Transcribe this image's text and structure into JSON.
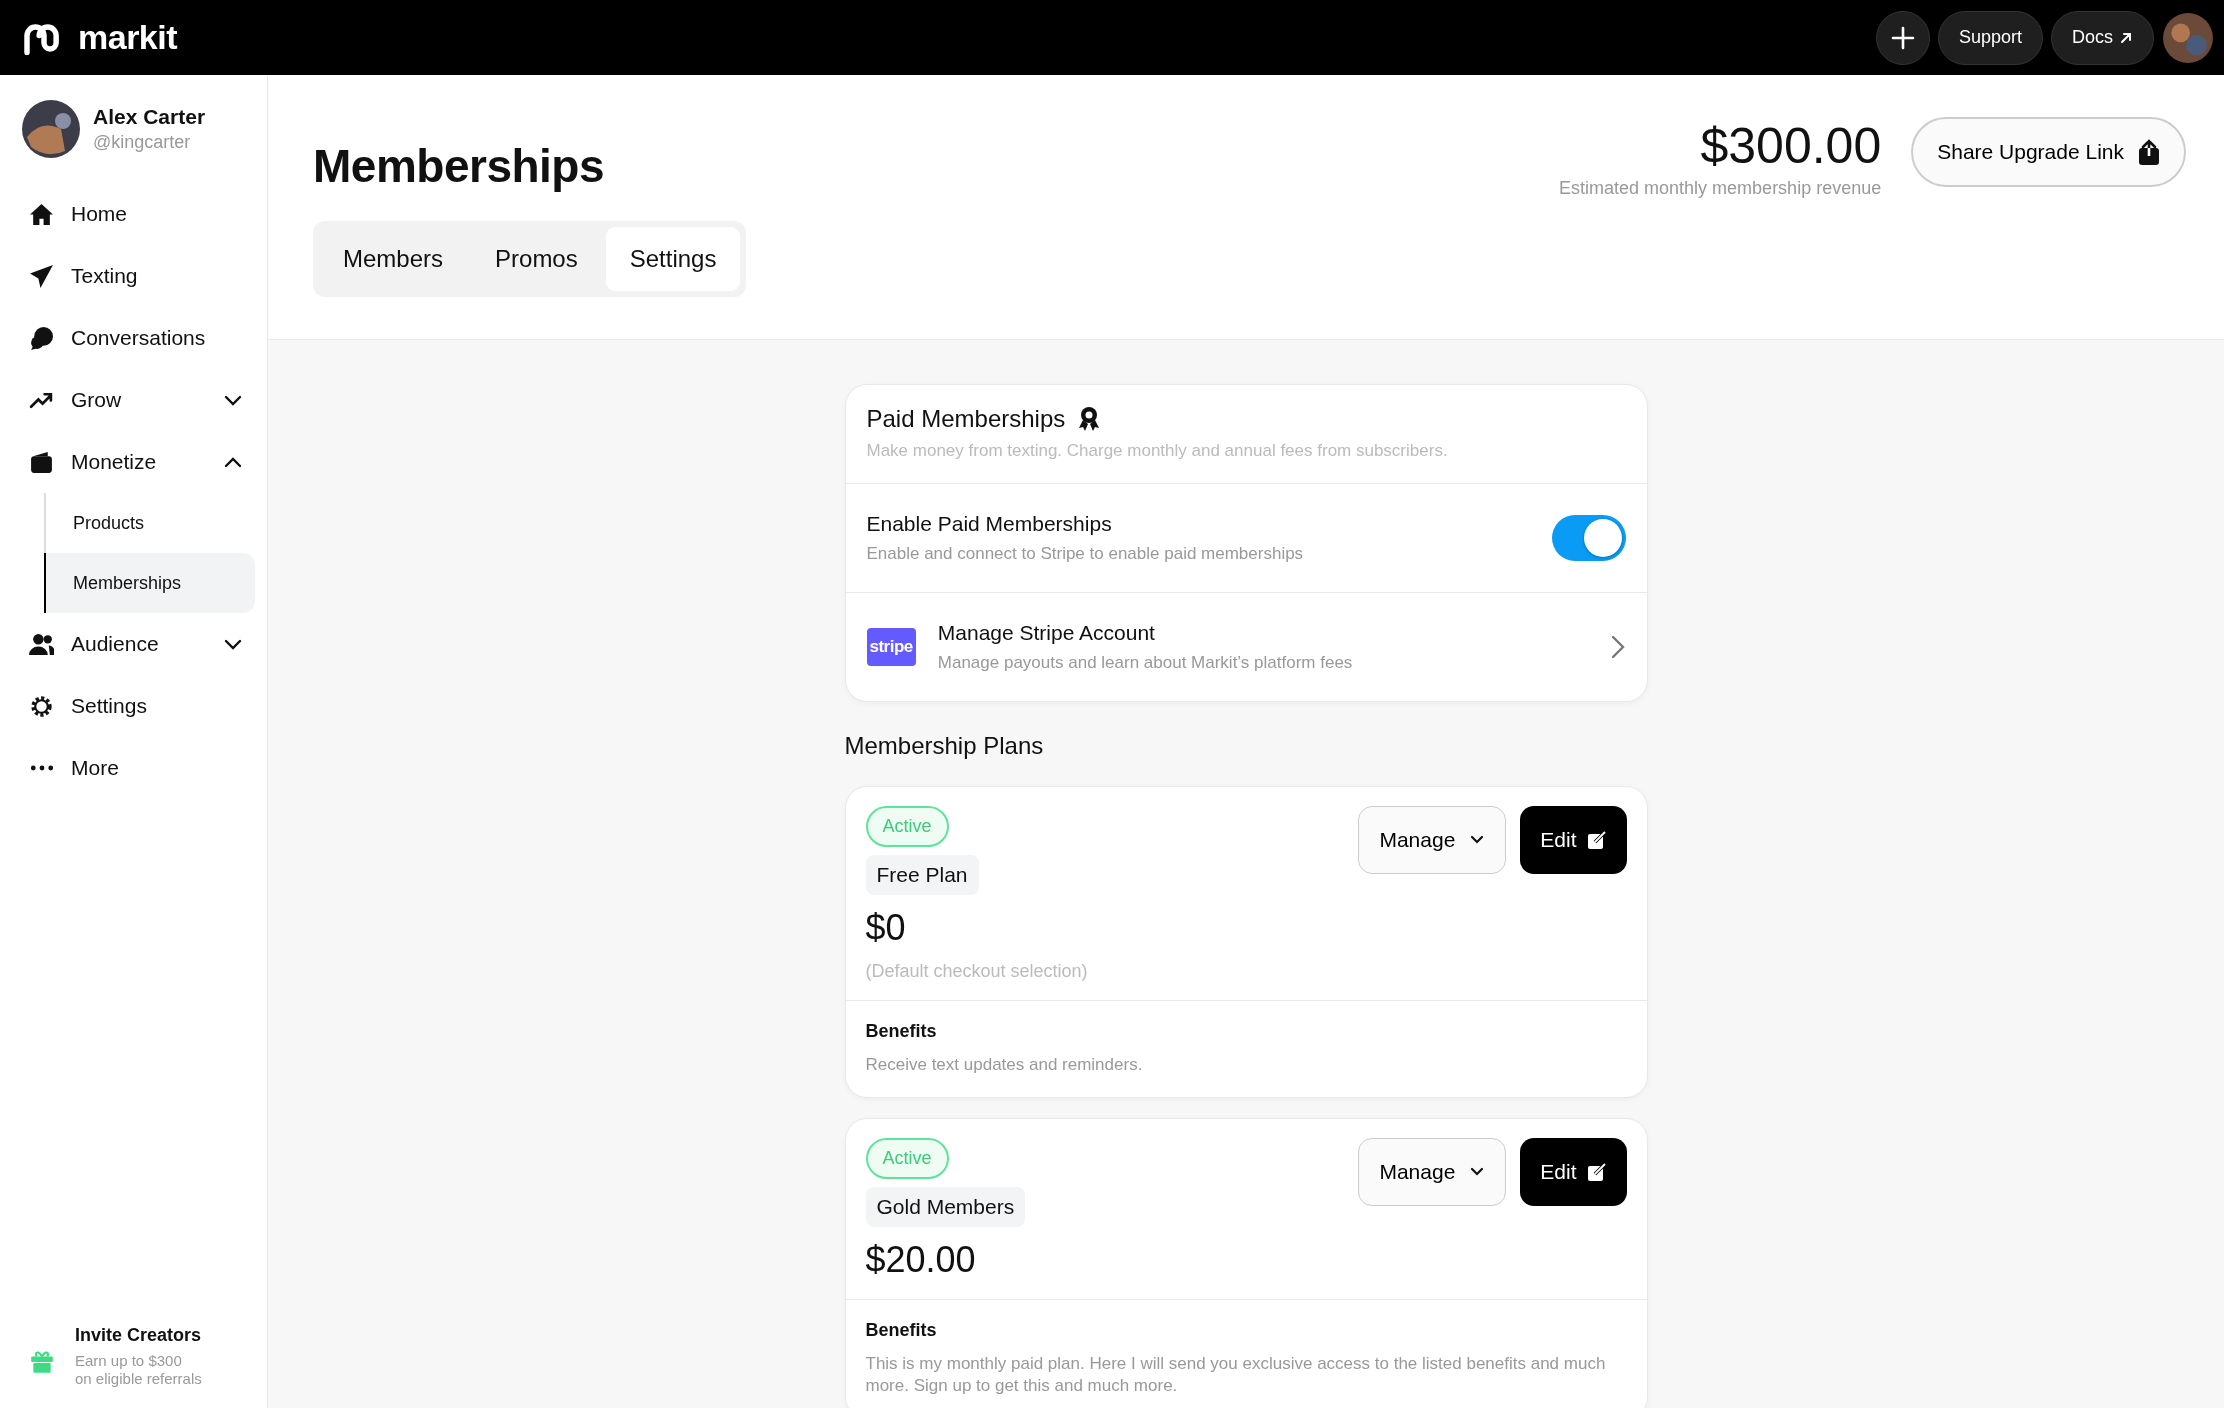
{
  "topbar": {
    "brand": "markit",
    "buttons": [
      "Support",
      "Docs"
    ]
  },
  "profile": {
    "name": "Alex Carter",
    "handle": "@kingcarter"
  },
  "nav": [
    {
      "label": "Home"
    },
    {
      "label": "Texting"
    },
    {
      "label": "Conversations"
    },
    {
      "label": "Grow",
      "expanded": false
    },
    {
      "label": "Monetize",
      "expanded": true,
      "children": [
        {
          "label": "Products",
          "selected": false
        },
        {
          "label": "Memberships",
          "selected": true
        }
      ]
    },
    {
      "label": "Audience",
      "expanded": false
    },
    {
      "label": "Settings"
    },
    {
      "label": "More"
    }
  ],
  "invite": {
    "title": "Invite Creators",
    "text": "Earn up to $300\non eligible referrals"
  },
  "page": {
    "title": "Memberships",
    "revenue": "$300.00",
    "revenue_label": "Estimated monthly membership revenue",
    "share_button": "Share Upgrade Link"
  },
  "tabs": [
    {
      "label": "Members",
      "selected": false
    },
    {
      "label": "Promos",
      "selected": false
    },
    {
      "label": "Settings",
      "selected": true
    }
  ],
  "paid": {
    "title": "Paid Memberships",
    "subtitle": "Make money from texting. Charge monthly and annual fees from subscribers.",
    "enable": {
      "title": "Enable Paid Memberships",
      "text": "Enable and connect to Stripe to enable paid memberships",
      "on": true
    },
    "stripe": {
      "logo_text": "stripe",
      "title": "Manage Stripe Account",
      "text": "Manage payouts and learn about Markit’s platform fees"
    }
  },
  "plans_title": "Membership Plans",
  "plans": [
    {
      "status": "Active",
      "name": "Free Plan",
      "price": "$0",
      "note": "(Default checkout selection)",
      "manage": "Manage",
      "edit": "Edit",
      "benefits_label": "Benefits",
      "benefits": "Receive text updates and reminders."
    },
    {
      "status": "Active",
      "name": "Gold Members",
      "price": "$20.00",
      "manage": "Manage",
      "edit": "Edit",
      "benefits_label": "Benefits",
      "benefits": "This is my monthly paid plan. Here I will send you exclusive access to the listed benefits and much more. Sign up to get this and much more."
    }
  ]
}
